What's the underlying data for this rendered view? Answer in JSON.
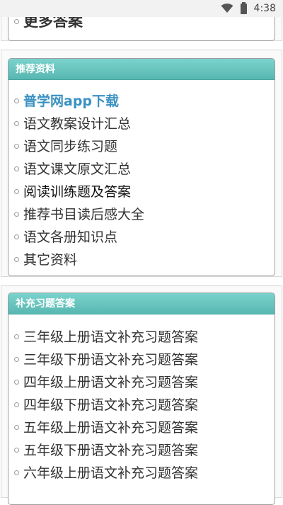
{
  "status": {
    "time": "4:38"
  },
  "top_section": {
    "more_link": "更多答案"
  },
  "recommend": {
    "title": "推荐资料",
    "items": [
      "普学网app下载",
      "语文教案设计汇总",
      "语文同步练习题",
      "语文课文原文汇总",
      "阅读训练题及答案",
      "推荐书目读后感大全",
      "语文各册知识点",
      "其它资料"
    ]
  },
  "supplement": {
    "title": "补充习题答案",
    "items": [
      "三年级上册语文补充习题答案",
      "三年级下册语文补充习题答案",
      "四年级上册语文补充习题答案",
      "四年级下册语文补充习题答案",
      "五年级上册语文补充习题答案",
      "五年级下册语文补充习题答案",
      "六年级上册语文补充习题答案"
    ]
  }
}
